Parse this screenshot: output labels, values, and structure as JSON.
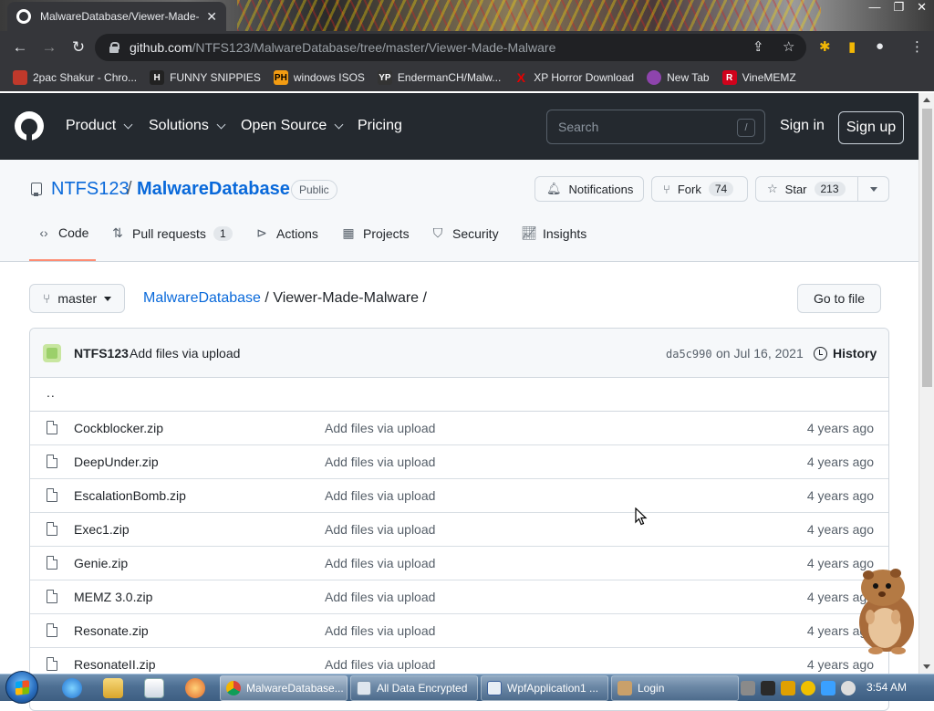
{
  "browser": {
    "tab_title": "MalwareDatabase/Viewer-Made-Malware",
    "url_domain": "github.com",
    "url_path": "/NTFS123/MalwareDatabase/tree/master/Viewer-Made-Malware",
    "bookmarks": [
      {
        "label": "2pac Shakur - Chro...",
        "icon": "chrome-app-icon",
        "color": "#c0392b"
      },
      {
        "label": "FUNNY SNIPPIES",
        "icon": "h-letter-icon",
        "color": "#222222"
      },
      {
        "label": "windows ISOS",
        "icon": "ph-logo-icon",
        "color": "#f39c12"
      },
      {
        "label": "EndermanCH/Malw...",
        "icon": "yp-logo-icon",
        "color": "#333333"
      },
      {
        "label": "XP Horror Download",
        "icon": "red-x-icon",
        "color": "#e60000"
      },
      {
        "label": "New Tab",
        "icon": "globe-icon",
        "color": "#8e44ad"
      },
      {
        "label": "VineMEMZ",
        "icon": "r-logo-icon",
        "color": "#d0021b"
      }
    ]
  },
  "github": {
    "nav": {
      "product": "Product",
      "solutions": "Solutions",
      "open_source": "Open Source",
      "pricing": "Pricing",
      "search_placeholder": "Search",
      "search_shortcut": "/",
      "sign_in": "Sign in",
      "sign_up": "Sign up"
    },
    "repo": {
      "owner": "NTFS123",
      "separator": "/",
      "name": "MalwareDatabase",
      "visibility": "Public",
      "notifications_label": "Notifications",
      "fork_label": "Fork",
      "fork_count": "74",
      "star_label": "Star",
      "star_count": "213"
    },
    "tabs": [
      {
        "label": "Code",
        "count": ""
      },
      {
        "label": "Pull requests",
        "count": "1"
      },
      {
        "label": "Actions",
        "count": ""
      },
      {
        "label": "Projects",
        "count": ""
      },
      {
        "label": "Security",
        "count": ""
      },
      {
        "label": "Insights",
        "count": ""
      }
    ],
    "branch": "master",
    "breadcrumb": {
      "root": "MalwareDatabase",
      "folder": "Viewer-Made-Malware",
      "trail": "/"
    },
    "go_to_file": "Go to file",
    "commit": {
      "author": "NTFS123",
      "message": "Add files via upload",
      "hash": "da5c990",
      "date": "on Jul 16, 2021",
      "history": "History"
    },
    "parent_dir": "..",
    "files": [
      {
        "name": "Cockblocker.zip",
        "message": "Add files via upload",
        "age": "4 years ago"
      },
      {
        "name": "DeepUnder.zip",
        "message": "Add files via upload",
        "age": "4 years ago"
      },
      {
        "name": "EscalationBomb.zip",
        "message": "Add files via upload",
        "age": "4 years ago"
      },
      {
        "name": "Exec1.zip",
        "message": "Add files via upload",
        "age": "4 years ago"
      },
      {
        "name": "Genie.zip",
        "message": "Add files via upload",
        "age": "4 years ago"
      },
      {
        "name": "MEMZ 3.0.zip",
        "message": "Add files via upload",
        "age": "4 years ago"
      },
      {
        "name": "Resonate.zip",
        "message": "Add files via upload",
        "age": "4 years ago"
      },
      {
        "name": "ResonateII.zip",
        "message": "Add files via upload",
        "age": "4 years ago"
      }
    ]
  },
  "taskbar": {
    "buttons": [
      {
        "label": "MalwareDatabase...",
        "icon": "chrome-icon"
      },
      {
        "label": "All Data Encrypted",
        "icon": "window-icon"
      },
      {
        "label": "WpfApplication1 ...",
        "icon": "vs-icon"
      },
      {
        "label": "Login",
        "icon": "app-icon"
      }
    ],
    "clock": "3:54 AM"
  }
}
